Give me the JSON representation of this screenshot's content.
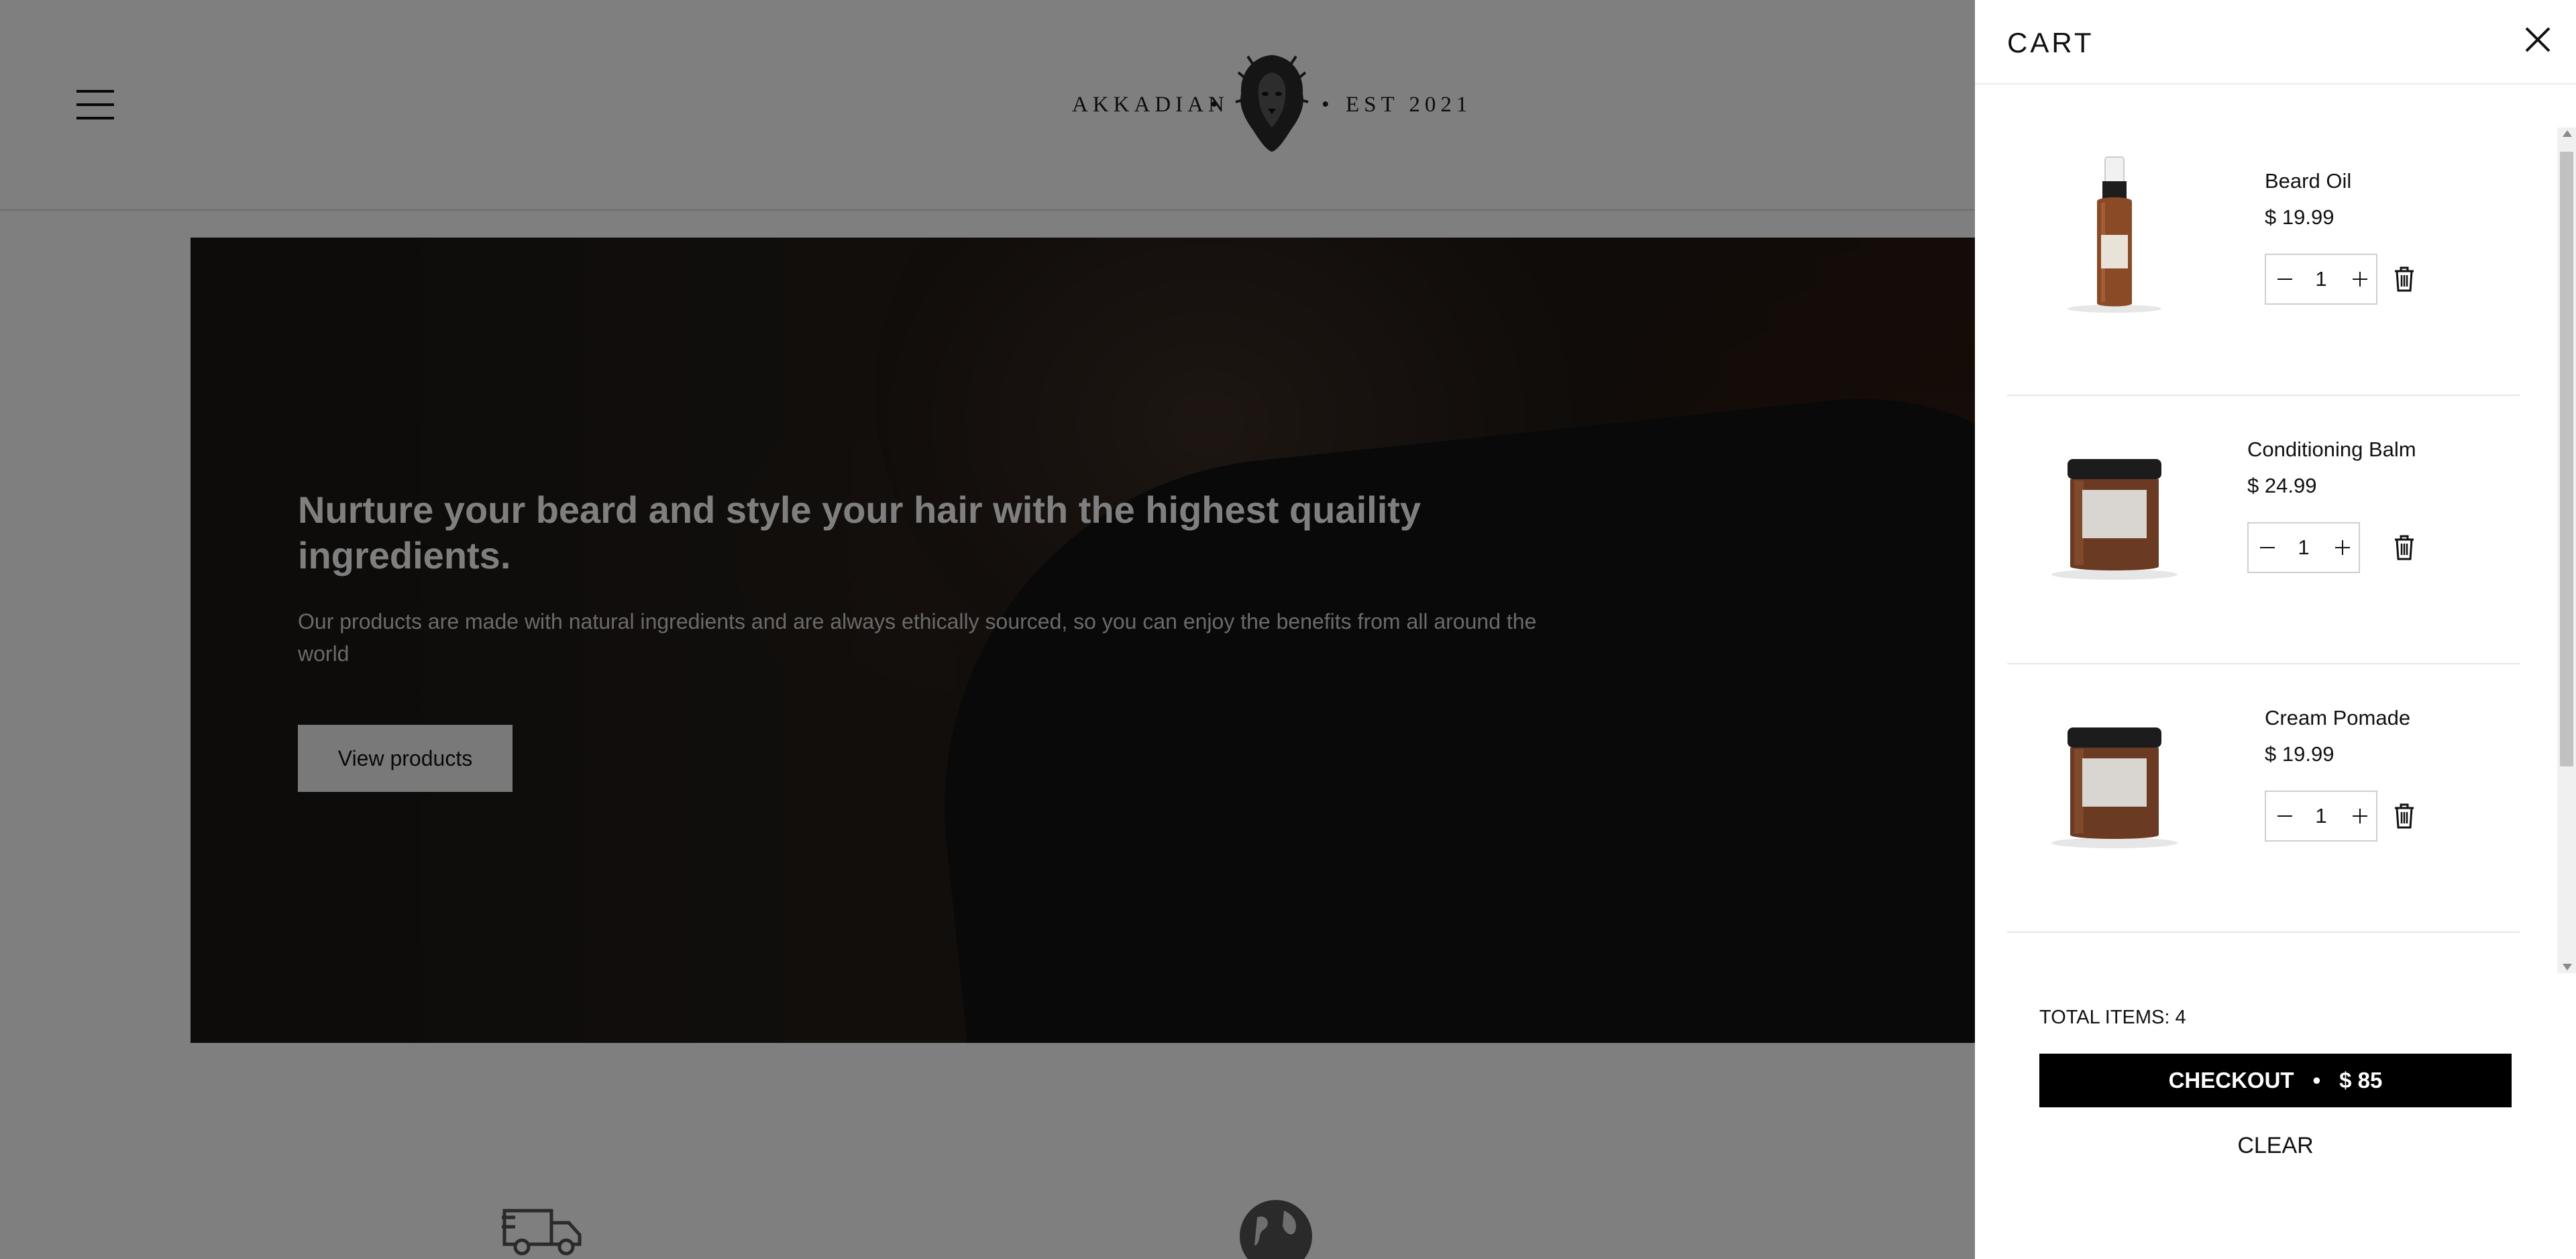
{
  "header": {
    "menu_icon": "hamburger-menu-icon",
    "logo": {
      "left": "AKKADIAN",
      "separator": "•",
      "right": "EST 2021",
      "emblem": "lion-head-logo"
    }
  },
  "hero": {
    "title": "Nurture your beard and style your hair with the highest quaility ingredients.",
    "subtitle": "Our products are made with natural ingredients and are always ethically sourced, so you can enjoy the benefits from all around the world",
    "cta_label": "View products"
  },
  "features": [
    {
      "icon": "truck-icon"
    },
    {
      "icon": "globe-icon"
    }
  ],
  "cart": {
    "title": "CART",
    "close_icon": "close-icon",
    "items": [
      {
        "name": "Beard Oil",
        "price": "$ 19.99",
        "quantity": "1",
        "image": "beard-oil-bottle"
      },
      {
        "name": "Conditioning Balm",
        "price": "$ 24.99",
        "quantity": "1",
        "image": "conditioning-balm-jar"
      },
      {
        "name": "Cream Pomade",
        "price": "$ 19.99",
        "quantity": "1",
        "image": "cream-pomade-jar"
      }
    ],
    "total_items_label": "TOTAL ITEMS: 4",
    "checkout": {
      "label": "CHECKOUT",
      "separator": "•",
      "amount": "$ 85"
    },
    "clear_label": "CLEAR"
  },
  "colors": {
    "overlay": "#000000",
    "checkout_bg": "#000000",
    "drawer_bg": "#ffffff"
  }
}
